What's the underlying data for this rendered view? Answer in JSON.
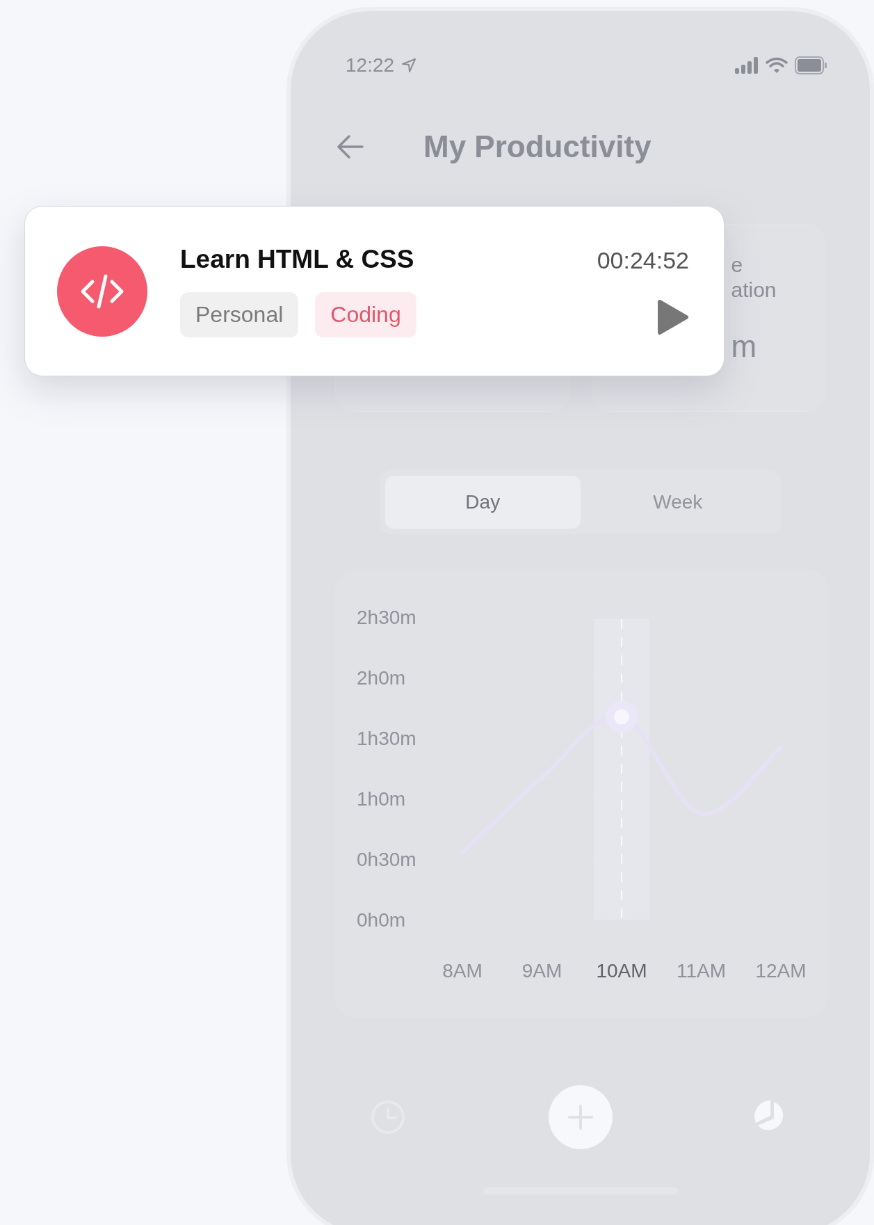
{
  "status_bar": {
    "time": "12:22"
  },
  "header": {
    "title": "My Productivity"
  },
  "stat_cards": [
    {
      "kind": "covered"
    },
    {
      "kind": "partial",
      "label_lines": [
        "e",
        "ation"
      ],
      "value": "m"
    }
  ],
  "period_tabs": [
    {
      "label": "Day",
      "selected": true
    },
    {
      "label": "Week",
      "selected": false
    }
  ],
  "chart": {
    "y_axis_labels": [
      "2h30m",
      "2h0m",
      "1h30m",
      "1h0m",
      "0h30m",
      "0h0m"
    ],
    "x_axis_labels": [
      {
        "label": "8AM",
        "selected": false
      },
      {
        "label": "9AM",
        "selected": false
      },
      {
        "label": "10AM",
        "selected": true
      },
      {
        "label": "11AM",
        "selected": false
      },
      {
        "label": "12AM",
        "selected": false
      }
    ]
  },
  "bottom_nav": [
    {
      "kind": "history"
    },
    {
      "kind": "add"
    },
    {
      "kind": "stats"
    }
  ],
  "task_card": {
    "title": "Learn HTML & CSS",
    "timer": "00:24:52",
    "tags": [
      {
        "label": "Personal",
        "color": "#7a7a7a"
      },
      {
        "label": "Coding",
        "color": "#e2566c"
      }
    ]
  }
}
